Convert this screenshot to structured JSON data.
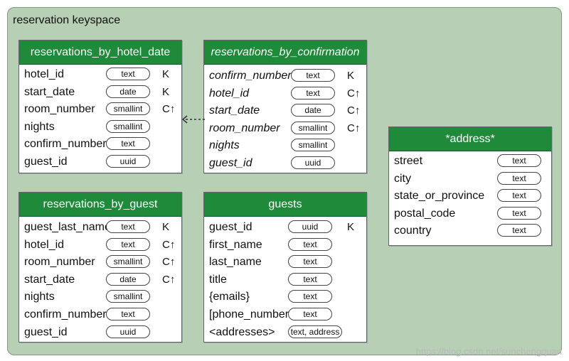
{
  "keyspace": {
    "label": "reservation keyspace"
  },
  "tables": {
    "by_hotel_date": {
      "title": "reservations_by_hotel_date",
      "fields": [
        {
          "name": "hotel_id",
          "type": "text",
          "key": "K"
        },
        {
          "name": "start_date",
          "type": "date",
          "key": "K"
        },
        {
          "name": "room_number",
          "type": "smallint",
          "key": "C↑"
        },
        {
          "name": "nights",
          "type": "smallint",
          "key": ""
        },
        {
          "name": "confirm_number",
          "type": "text",
          "key": ""
        },
        {
          "name": "guest_id",
          "type": "uuid",
          "key": ""
        }
      ]
    },
    "by_confirmation": {
      "title": "reservations_by_confirmation",
      "fields": [
        {
          "name": "confirm_number",
          "type": "text",
          "key": "K"
        },
        {
          "name": "hotel_id",
          "type": "text",
          "key": "C↑"
        },
        {
          "name": "start_date",
          "type": "date",
          "key": "C↑"
        },
        {
          "name": "room_number",
          "type": "smallint",
          "key": "C↑"
        },
        {
          "name": "nights",
          "type": "smallint",
          "key": ""
        },
        {
          "name": "guest_id",
          "type": "uuid",
          "key": ""
        }
      ]
    },
    "by_guest": {
      "title": "reservations_by_guest",
      "fields": [
        {
          "name": "guest_last_name",
          "type": "text",
          "key": "K"
        },
        {
          "name": "hotel_id",
          "type": "text",
          "key": "C↑"
        },
        {
          "name": "room_number",
          "type": "smallint",
          "key": "C↑"
        },
        {
          "name": "start_date",
          "type": "date",
          "key": "C↑"
        },
        {
          "name": "nights",
          "type": "smallint",
          "key": ""
        },
        {
          "name": "confirm_number",
          "type": "text",
          "key": ""
        },
        {
          "name": "guest_id",
          "type": "uuid",
          "key": ""
        }
      ]
    },
    "guests": {
      "title": "guests",
      "fields": [
        {
          "name": "guest_id",
          "type": "uuid",
          "key": "K"
        },
        {
          "name": "first_name",
          "type": "text",
          "key": ""
        },
        {
          "name": "last_name",
          "type": "text",
          "key": ""
        },
        {
          "name": "title",
          "type": "text",
          "key": ""
        },
        {
          "name": "{emails}",
          "type": "text",
          "key": ""
        },
        {
          "name": "[phone_numbers]",
          "type": "text",
          "key": ""
        },
        {
          "name": "<addresses>",
          "type": "text, address",
          "key": ""
        }
      ]
    },
    "address": {
      "title": "*address*",
      "fields": [
        {
          "name": "street",
          "type": "text",
          "key": ""
        },
        {
          "name": "city",
          "type": "text",
          "key": ""
        },
        {
          "name": "state_or_province",
          "type": "text",
          "key": ""
        },
        {
          "name": "postal_code",
          "type": "text",
          "key": ""
        },
        {
          "name": "country",
          "type": "text",
          "key": ""
        }
      ]
    }
  },
  "watermark": "https://blog.csdn.net/sunchengquan"
}
